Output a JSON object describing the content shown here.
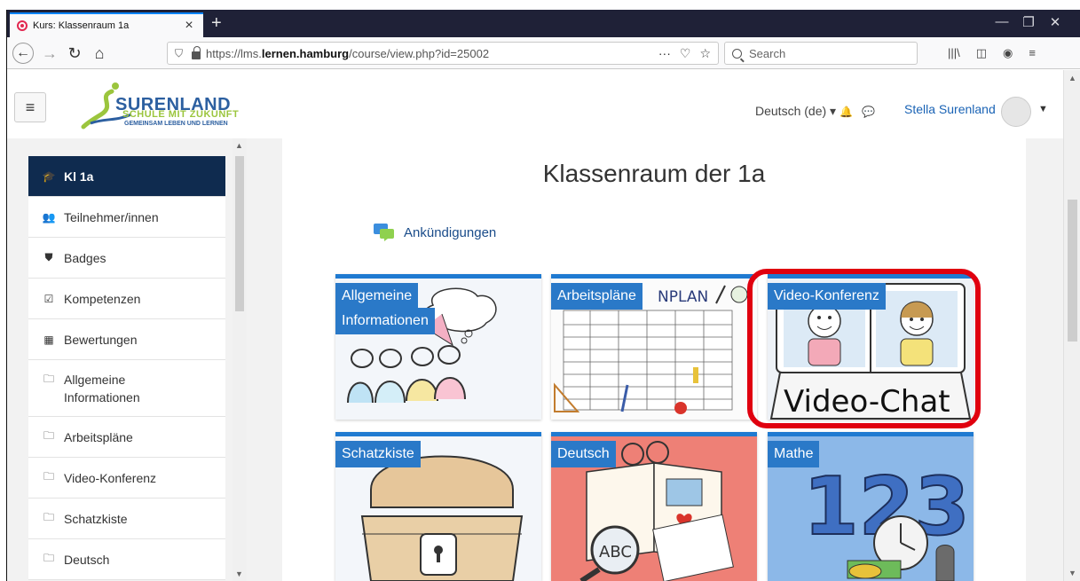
{
  "browser": {
    "tab_title": "Kurs: Klassenraum 1a",
    "tab_close": "×",
    "new_tab": "+",
    "url_host_pre": "https://lms.",
    "url_host_bold": "lernen.hamburg",
    "url_path": "/course/view.php?id=25002",
    "url_more": "···",
    "search_placeholder": "Search",
    "win_minimize": "—",
    "win_restore": "❐",
    "win_close": "✕"
  },
  "header": {
    "logo_main": "SURENLAND",
    "logo_sub1": "SCHULE MIT ZUKUNFT",
    "logo_sub2": "GEMEINSAM LEBEN UND LERNEN",
    "language": "Deutsch (de) ▾",
    "user_name": "Stella Surenland",
    "hamburger": "≡"
  },
  "sidebar": {
    "items": [
      {
        "label": "Kl 1a",
        "icon": "graduation-cap-icon",
        "glyph": "🎓"
      },
      {
        "label": "Teilnehmer/innen",
        "icon": "users-icon",
        "glyph": "👥"
      },
      {
        "label": "Badges",
        "icon": "shield-icon",
        "glyph": "⛊"
      },
      {
        "label": "Kompetenzen",
        "icon": "checkbox-icon",
        "glyph": "☑"
      },
      {
        "label": "Bewertungen",
        "icon": "table-icon",
        "glyph": "▦"
      },
      {
        "label": "Allgemeine",
        "label2": "Informationen",
        "icon": "folder-icon",
        "glyph": "🗀"
      },
      {
        "label": "Arbeitspläne",
        "icon": "folder-icon",
        "glyph": "🗀"
      },
      {
        "label": "Video-Konferenz",
        "icon": "folder-icon",
        "glyph": "🗀"
      },
      {
        "label": "Schatzkiste",
        "icon": "folder-icon",
        "glyph": "🗀"
      },
      {
        "label": "Deutsch",
        "icon": "folder-icon",
        "glyph": "🗀"
      }
    ]
  },
  "main": {
    "title": "Klassenraum der 1a",
    "announcements": "Ankündigungen",
    "tiles": [
      {
        "label": "Allgemeine",
        "label2": "Informationen"
      },
      {
        "label": "Arbeitspläne"
      },
      {
        "label": "Video-Konferenz"
      },
      {
        "label": "Schatzkiste"
      },
      {
        "label": "Deutsch"
      },
      {
        "label": "Mathe"
      }
    ],
    "tile_art": {
      "plan_heading": "NPLAN",
      "video_chat": "Video-Chat",
      "abc": "ABC",
      "mathe_digits": "123"
    }
  },
  "colors": {
    "accent": "#2a79c8",
    "sidebar_active": "#0f2b4f",
    "highlight": "#e0000f"
  }
}
